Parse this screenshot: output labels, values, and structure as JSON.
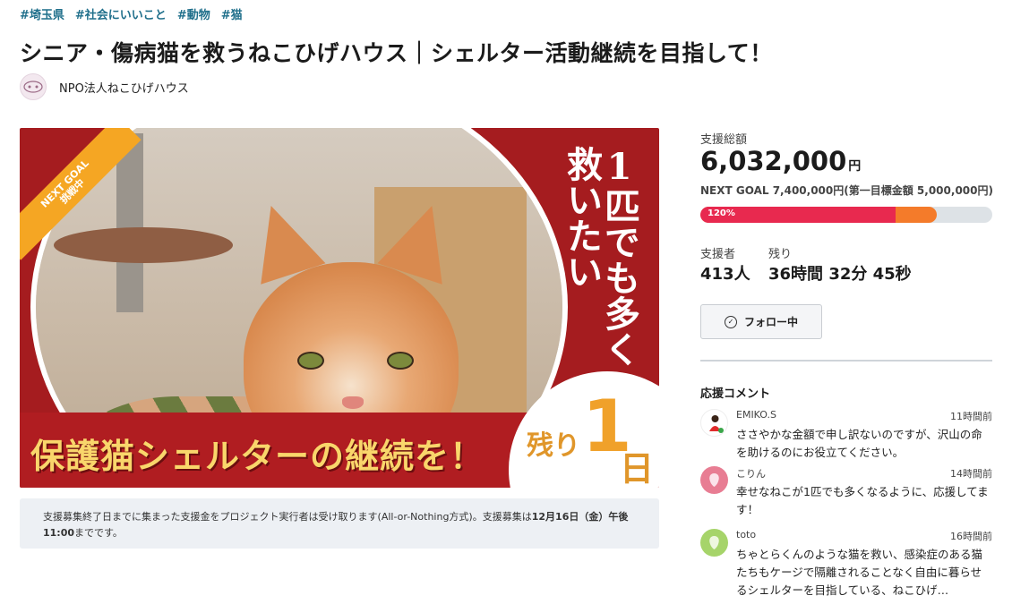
{
  "tags": [
    "#埼玉県",
    "#社会にいいこと",
    "#動物",
    "#猫"
  ],
  "title": "シニア・傷病猫を救うねこひげハウス｜シェルター活動継続を目指して！",
  "organization": {
    "name": "NPO法人ねこひげハウス"
  },
  "hero": {
    "ribbon_line1": "NEXT GOAL",
    "ribbon_line2": "挑戦中",
    "slogan": "1匹でも多く救いたい",
    "banner_text": "保護猫シェルターの継続を！",
    "remain_label": "残り",
    "remain_number": "1",
    "remain_unit": "日"
  },
  "notice": {
    "text": "支援募集終了日までに集まった支援金をプロジェクト実行者は受け取ります(All-or-Nothing方式)。支援募集は",
    "deadline": "12月16日（金）午後11:00",
    "suffix": "までです。"
  },
  "funding": {
    "label": "支援総額",
    "amount": "6,032,000",
    "currency": "円",
    "next_goal": "NEXT GOAL 7,400,000円(第一目標金額 5,000,000円)",
    "progress_label": "120%",
    "progress_primary_fraction": 0.67,
    "progress_secondary_fraction": 0.81
  },
  "stats": {
    "supporters_label": "支援者",
    "supporters_value": "413人",
    "remaining_label": "残り",
    "remaining_value": "36時間 32分 45秒"
  },
  "follow_button": {
    "label": "フォロー中",
    "icon": "check-circle-icon"
  },
  "comments": {
    "title": "応援コメント",
    "items": [
      {
        "name": "EMIKO.S",
        "time": "11時間前",
        "text": "ささやかな金額で申し訳ないのですが、沢山の命を助けるのにお役立てください。",
        "avatar_color": "#ffffff"
      },
      {
        "name": "こりん",
        "time": "14時間前",
        "text": "幸せなねこが1匹でも多くなるように、応援してます！",
        "avatar_color": "#e87d93"
      },
      {
        "name": "toto",
        "time": "16時間前",
        "text": "ちゃとらくんのような猫を救い、感染症のある猫たちもケージで隔離されることなく自由に暮らせるシェルターを目指している、ねこひげ…",
        "avatar_color": "#a6d46a"
      }
    ]
  },
  "colors": {
    "accent_red": "#e8294f",
    "accent_orange": "#f47b2a",
    "tag_blue": "#1f6f8b",
    "banner_red": "#a51c1f"
  }
}
